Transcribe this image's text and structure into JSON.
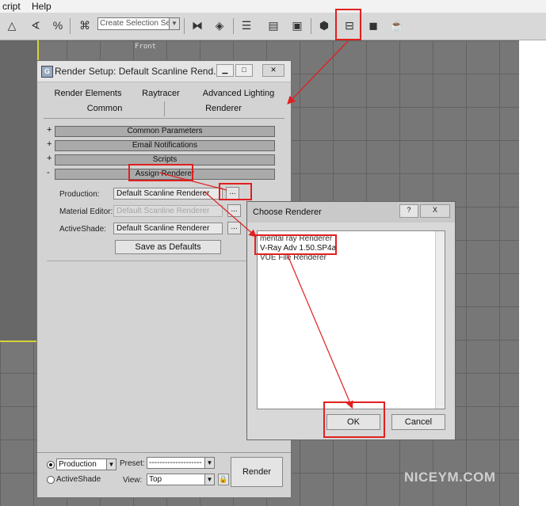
{
  "menu": {
    "items": [
      "cript",
      "Help"
    ]
  },
  "toolbar": {
    "selection_set_placeholder": "Create Selection Set"
  },
  "viewport": {
    "label": "Front"
  },
  "render_setup": {
    "title": "Render Setup: Default Scanline Rend...",
    "tabs_row1": [
      "Render Elements",
      "Raytracer",
      "Advanced Lighting"
    ],
    "tabs_row2": [
      "Common",
      "Renderer"
    ],
    "rollouts": [
      {
        "sign": "+",
        "label": "Common Parameters"
      },
      {
        "sign": "+",
        "label": "Email Notifications"
      },
      {
        "sign": "+",
        "label": "Scripts"
      },
      {
        "sign": "-",
        "label": "Assign Renderer"
      }
    ],
    "assign": {
      "production_label": "Production:",
      "production_value": "Default Scanline Renderer",
      "material_label": "Material Editor:",
      "material_value": "Default Scanline Renderer",
      "activeshade_label": "ActiveShade:",
      "activeshade_value": "Default Scanline Renderer",
      "browse": "...",
      "save_defaults": "Save as Defaults"
    },
    "bottom": {
      "production_radio": "Production",
      "activeshade_radio": "ActiveShade",
      "preset_label": "Preset:",
      "preset_value": "--------------------",
      "view_label": "View:",
      "view_value": "Top",
      "render_button": "Render"
    }
  },
  "choose_renderer": {
    "title": "Choose Renderer",
    "help": "?",
    "close": "X",
    "items": [
      "mental ray Renderer",
      "V-Ray Adv 1.50.SP4a",
      "VUE File Renderer"
    ],
    "ok": "OK",
    "cancel": "Cancel"
  },
  "watermark": "NICEYM.COM",
  "colors": {
    "highlight": "#e0201f",
    "viewport_border": "#d7d23a"
  }
}
